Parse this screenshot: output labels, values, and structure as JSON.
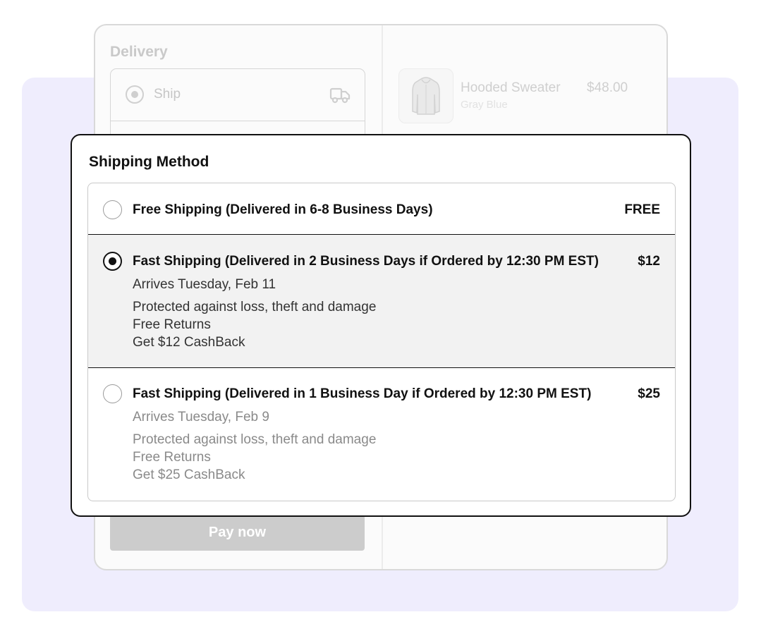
{
  "checkout": {
    "delivery_title": "Delivery",
    "ship_label": "Ship",
    "pay_button": "Pay now",
    "product": {
      "name": "Hooded Sweater",
      "price": "$48.00",
      "variant": "Gray Blue"
    }
  },
  "shipping_modal": {
    "title": "Shipping Method",
    "options": [
      {
        "title": "Free Shipping (Delivered in 6-8 Business Days)",
        "price": "FREE",
        "selected": false
      },
      {
        "title": "Fast Shipping (Delivered in 2 Business Days if Ordered by 12:30 PM EST)",
        "price": "$12",
        "arrival": "Arrives Tuesday, Feb 11",
        "benefits": [
          "Protected against loss, theft and damage",
          "Free Returns",
          "Get $12 CashBack"
        ],
        "selected": true
      },
      {
        "title": "Fast Shipping (Delivered in 1 Business Day if Ordered by 12:30 PM EST)",
        "price": "$25",
        "arrival": "Arrives Tuesday, Feb 9",
        "benefits": [
          "Protected against loss, theft and damage",
          "Free Returns",
          "Get $25 CashBack"
        ],
        "selected": false
      }
    ]
  },
  "colors": {
    "background_panel": "#efedfd",
    "selected_row": "#f2f2f2",
    "pay_button_disabled": "#cccccc"
  },
  "icons": {
    "ship": "truck-icon",
    "product": "sweater-icon"
  }
}
